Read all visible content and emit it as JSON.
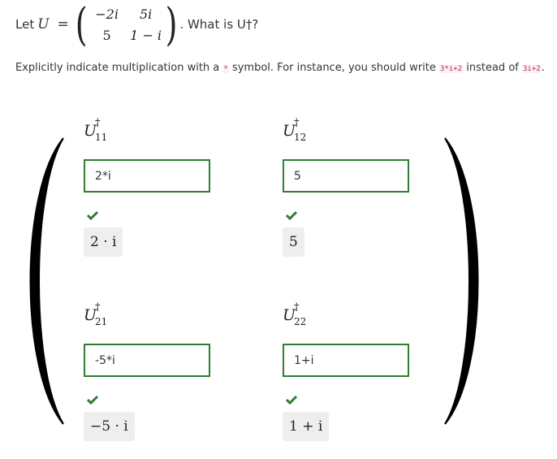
{
  "question": {
    "prefix": "Let",
    "matrix_symbol": "U",
    "equals": "=",
    "matrix": [
      [
        "−2i",
        "5i"
      ],
      [
        "5",
        "1 − i"
      ]
    ],
    "suffix": ". What is U†?"
  },
  "instruction": {
    "text_before": "Explicitly indicate multiplication with a",
    "symbol": "*",
    "text_middle": "symbol. For instance, you should write",
    "good_example": "3*i+2",
    "text_after": "instead of",
    "bad_example": "3i+2",
    "end": "."
  },
  "cells": [
    {
      "label": "U",
      "sup": "†",
      "sub": "11",
      "value": "2*i",
      "preview": "2 · i",
      "correct": true
    },
    {
      "label": "U",
      "sup": "†",
      "sub": "12",
      "value": "5",
      "preview": "5",
      "correct": true
    },
    {
      "label": "U",
      "sup": "†",
      "sub": "21",
      "value": "-5*i",
      "preview": "−5 · i",
      "correct": true
    },
    {
      "label": "U",
      "sup": "†",
      "sub": "22",
      "value": "1+i",
      "preview": "1 + i",
      "correct": true
    }
  ],
  "colors": {
    "correct_border": "#2e7d32",
    "check_mark": "#2e7d32",
    "preview_bg": "#eeeeee",
    "code_text": "#c7254e"
  }
}
